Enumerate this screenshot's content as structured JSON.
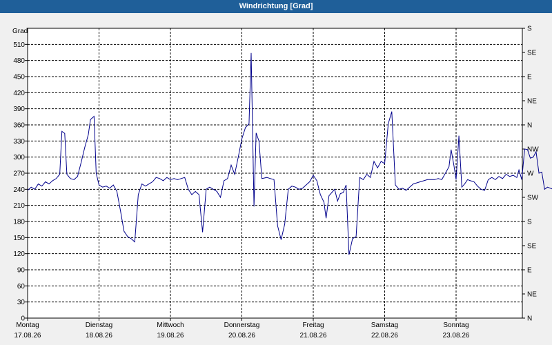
{
  "window": {
    "title": "Windrichtung [Grad]"
  },
  "colors": {
    "titlebar": "#1f5f99",
    "line": "#00008b",
    "grid": "#000000",
    "background": "#f0f0f0"
  },
  "chart_data": {
    "type": "line",
    "title": "Windrichtung [Grad]",
    "ylabel": "Grad",
    "ylim": [
      0,
      540
    ],
    "yticks": [
      0,
      30,
      60,
      90,
      120,
      150,
      180,
      210,
      240,
      270,
      300,
      330,
      360,
      390,
      420,
      450,
      480,
      510
    ],
    "y2ticks": [
      "N",
      "NE",
      "E",
      "SE",
      "S",
      "SW",
      "W",
      "NW",
      "N",
      "NE",
      "E",
      "SE",
      "S"
    ],
    "xlim": [
      0,
      7
    ],
    "x_categories": [
      {
        "day": "Montag",
        "date": "17.08.26"
      },
      {
        "day": "Dienstag",
        "date": "18.08.26"
      },
      {
        "day": "Mittwoch",
        "date": "19.08.26"
      },
      {
        "day": "Donnerstag",
        "date": "20.08.26"
      },
      {
        "day": "Freitag",
        "date": "21.08.26"
      },
      {
        "day": "Samstag",
        "date": "22.08.26"
      },
      {
        "day": "Sonntag",
        "date": "23.08.26"
      }
    ],
    "grid": true,
    "series": [
      {
        "points": [
          [
            0.0,
            238
          ],
          [
            0.05,
            244
          ],
          [
            0.1,
            240
          ],
          [
            0.15,
            250
          ],
          [
            0.2,
            246
          ],
          [
            0.25,
            254
          ],
          [
            0.3,
            250
          ],
          [
            0.35,
            256
          ],
          [
            0.4,
            260
          ],
          [
            0.45,
            268
          ],
          [
            0.48,
            348
          ],
          [
            0.52,
            344
          ],
          [
            0.55,
            268
          ],
          [
            0.6,
            260
          ],
          [
            0.65,
            258
          ],
          [
            0.7,
            264
          ],
          [
            0.75,
            290
          ],
          [
            0.8,
            318
          ],
          [
            0.85,
            342
          ],
          [
            0.88,
            370
          ],
          [
            0.93,
            376
          ],
          [
            0.96,
            270
          ],
          [
            1.0,
            248
          ],
          [
            1.05,
            244
          ],
          [
            1.1,
            246
          ],
          [
            1.15,
            242
          ],
          [
            1.2,
            248
          ],
          [
            1.25,
            236
          ],
          [
            1.3,
            200
          ],
          [
            1.35,
            162
          ],
          [
            1.4,
            152
          ],
          [
            1.45,
            148
          ],
          [
            1.5,
            142
          ],
          [
            1.55,
            230
          ],
          [
            1.6,
            250
          ],
          [
            1.65,
            246
          ],
          [
            1.7,
            250
          ],
          [
            1.75,
            254
          ],
          [
            1.8,
            262
          ],
          [
            1.85,
            260
          ],
          [
            1.9,
            256
          ],
          [
            1.95,
            262
          ],
          [
            2.0,
            258
          ],
          [
            2.05,
            260
          ],
          [
            2.1,
            258
          ],
          [
            2.15,
            260
          ],
          [
            2.2,
            262
          ],
          [
            2.25,
            240
          ],
          [
            2.3,
            230
          ],
          [
            2.35,
            236
          ],
          [
            2.4,
            230
          ],
          [
            2.45,
            160
          ],
          [
            2.5,
            240
          ],
          [
            2.55,
            244
          ],
          [
            2.6,
            240
          ],
          [
            2.65,
            236
          ],
          [
            2.7,
            225
          ],
          [
            2.75,
            256
          ],
          [
            2.8,
            260
          ],
          [
            2.85,
            285
          ],
          [
            2.9,
            268
          ],
          [
            2.95,
            300
          ],
          [
            3.0,
            334
          ],
          [
            3.05,
            355
          ],
          [
            3.1,
            362
          ],
          [
            3.13,
            494
          ],
          [
            3.17,
            208
          ],
          [
            3.2,
            345
          ],
          [
            3.24,
            330
          ],
          [
            3.28,
            260
          ],
          [
            3.35,
            262
          ],
          [
            3.4,
            260
          ],
          [
            3.45,
            258
          ],
          [
            3.5,
            172
          ],
          [
            3.55,
            146
          ],
          [
            3.6,
            175
          ],
          [
            3.65,
            240
          ],
          [
            3.7,
            246
          ],
          [
            3.75,
            244
          ],
          [
            3.8,
            240
          ],
          [
            3.85,
            242
          ],
          [
            3.9,
            248
          ],
          [
            3.95,
            254
          ],
          [
            4.0,
            266
          ],
          [
            4.05,
            256
          ],
          [
            4.1,
            230
          ],
          [
            4.15,
            216
          ],
          [
            4.18,
            186
          ],
          [
            4.22,
            228
          ],
          [
            4.26,
            234
          ],
          [
            4.3,
            240
          ],
          [
            4.34,
            218
          ],
          [
            4.38,
            232
          ],
          [
            4.42,
            234
          ],
          [
            4.46,
            248
          ],
          [
            4.5,
            118
          ],
          [
            4.55,
            148
          ],
          [
            4.6,
            152
          ],
          [
            4.65,
            262
          ],
          [
            4.7,
            258
          ],
          [
            4.75,
            268
          ],
          [
            4.8,
            262
          ],
          [
            4.85,
            292
          ],
          [
            4.9,
            280
          ],
          [
            4.95,
            292
          ],
          [
            5.0,
            288
          ],
          [
            5.05,
            362
          ],
          [
            5.1,
            385
          ],
          [
            5.15,
            248
          ],
          [
            5.2,
            240
          ],
          [
            5.25,
            242
          ],
          [
            5.3,
            238
          ],
          [
            5.35,
            244
          ],
          [
            5.4,
            250
          ],
          [
            5.45,
            252
          ],
          [
            5.5,
            254
          ],
          [
            5.55,
            256
          ],
          [
            5.6,
            258
          ],
          [
            5.65,
            258
          ],
          [
            5.7,
            258
          ],
          [
            5.75,
            260
          ],
          [
            5.8,
            258
          ],
          [
            5.85,
            270
          ],
          [
            5.9,
            282
          ],
          [
            5.93,
            314
          ],
          [
            5.97,
            284
          ],
          [
            6.0,
            258
          ],
          [
            6.04,
            340
          ],
          [
            6.08,
            244
          ],
          [
            6.12,
            250
          ],
          [
            6.16,
            258
          ],
          [
            6.2,
            256
          ],
          [
            6.25,
            254
          ],
          [
            6.3,
            246
          ],
          [
            6.35,
            240
          ],
          [
            6.4,
            238
          ],
          [
            6.45,
            258
          ],
          [
            6.5,
            262
          ],
          [
            6.55,
            258
          ],
          [
            6.6,
            264
          ],
          [
            6.65,
            260
          ],
          [
            6.7,
            268
          ],
          [
            6.75,
            264
          ],
          [
            6.8,
            266
          ],
          [
            6.85,
            262
          ],
          [
            6.88,
            276
          ],
          [
            6.92,
            258
          ],
          [
            6.96,
            315
          ],
          [
            7.0,
            314
          ],
          [
            7.04,
            298
          ],
          [
            7.08,
            300
          ],
          [
            7.12,
            310
          ],
          [
            7.16,
            270
          ],
          [
            7.2,
            272
          ],
          [
            7.24,
            240
          ],
          [
            7.28,
            244
          ],
          [
            7.32,
            242
          ],
          [
            7.36,
            240
          ],
          [
            7.4,
            238
          ]
        ]
      }
    ]
  }
}
